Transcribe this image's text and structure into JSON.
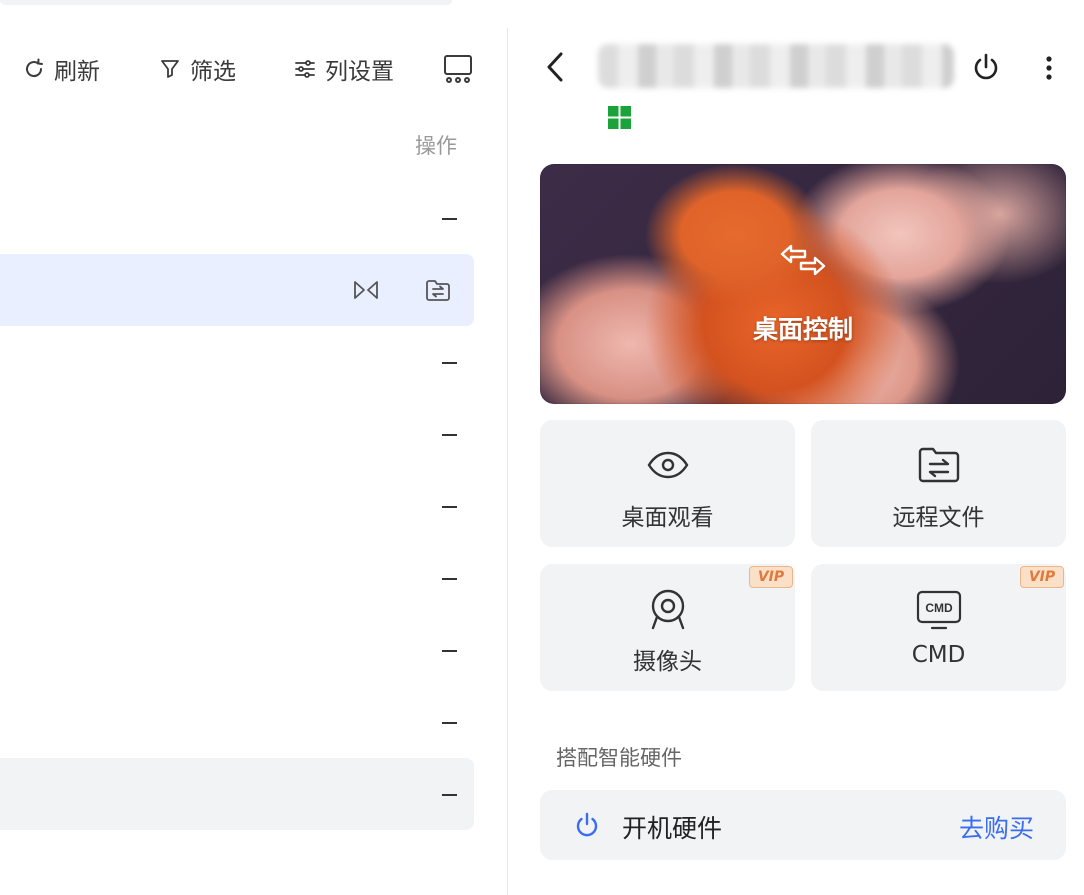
{
  "toolbar": {
    "refresh_label": "刷新",
    "filter_label": "筛选",
    "columns_label": "列设置"
  },
  "table": {
    "action_header": "操作",
    "rows": [
      {
        "state": "normal",
        "value": "—"
      },
      {
        "state": "selected",
        "actions": [
          "desktop-watch-icon",
          "remote-file-icon"
        ]
      },
      {
        "state": "normal",
        "value": "—"
      },
      {
        "state": "normal",
        "value": "—"
      },
      {
        "state": "normal",
        "value": "—"
      },
      {
        "state": "normal",
        "value": "—"
      },
      {
        "state": "normal",
        "value": "—"
      },
      {
        "state": "normal",
        "value": "—"
      },
      {
        "state": "hover",
        "value": "—"
      }
    ]
  },
  "panel": {
    "os": "windows",
    "hero_label": "桌面控制",
    "tiles": [
      {
        "label": "桌面观看",
        "icon": "eye-icon"
      },
      {
        "label": "远程文件",
        "icon": "folder-transfer-icon"
      },
      {
        "label": "摄像头",
        "icon": "camera-icon",
        "badge": "VIP"
      },
      {
        "label": "CMD",
        "icon": "cmd-icon",
        "badge": "VIP"
      }
    ],
    "section_title": "搭配智能硬件",
    "hardware": {
      "label": "开机硬件",
      "buy_label": "去购买"
    }
  },
  "colors": {
    "accent": "#3a6df0",
    "selected_row": "#e9efff",
    "tile_bg": "#f2f3f5",
    "windows_green": "#19a33a"
  }
}
